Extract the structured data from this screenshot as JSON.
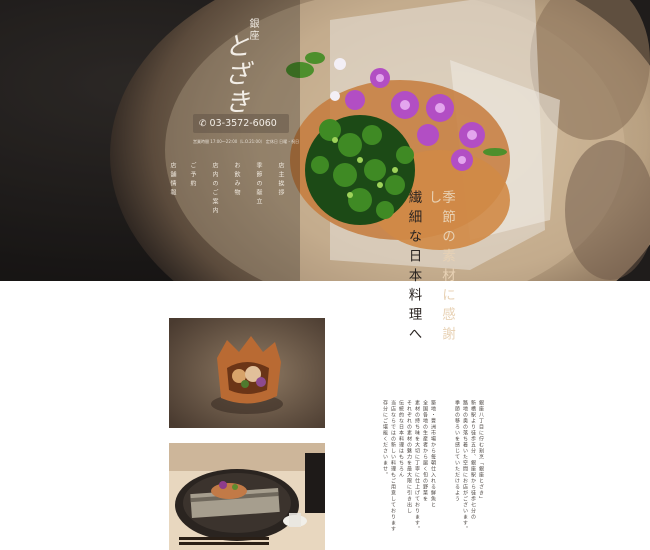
{
  "header": {
    "logo_sub": "銀座",
    "logo": "とざき",
    "phone_icon": "phone-icon",
    "phone": "03-3572-6060",
    "hours": "営業時間 17:00～22:00（L.O.21:00） 定休日 日曜・祝日"
  },
  "nav": {
    "items": [
      "店主挨拶",
      "季節の献立",
      "お飲み物",
      "店内のご案内",
      "ご予約",
      "店舗情報"
    ]
  },
  "tagline": {
    "line1": "季節の素材に感謝し",
    "line2": "繊細な日本料理へ"
  },
  "body": {
    "paragraphs": [
      "銀座八丁目に佇む割烹「銀座とざき」",
      "新橋駅より徒歩五分、銀座駅から徒歩七分の",
      "路地の奥の落ち着いた空間にお店がございます。",
      "季節の移ろいを感じていただけるよう",
      "",
      "築地・豊洲市場から毎朝仕入れる鮮魚と",
      "全国各地の生産者から届く旬の野菜を",
      "素材の持ち味を大切に丁寧に仕上げております。",
      "それぞれの素材の魅力を最大限に引き出し",
      "伝統的な日本料理はもちろん",
      "当店ならではの新しい料理もご用意しております",
      "存分にご堪能くださいませ。"
    ]
  }
}
